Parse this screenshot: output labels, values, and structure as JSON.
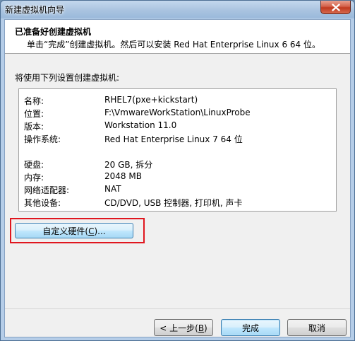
{
  "window": {
    "title": "新建虚拟机向导"
  },
  "header": {
    "title": "已准备好创建虚拟机",
    "subtitle": "单击“完成”创建虚拟机。然后可以安装 Red Hat Enterprise Linux 6 64 位。"
  },
  "summary": {
    "label": "将使用下列设置创建虚拟机:",
    "rows": [
      {
        "key": "名称:",
        "value": "RHEL7(pxe+kickstart)"
      },
      {
        "key": "位置:",
        "value": "F:\\VmwareWorkStation\\LinuxProbe"
      },
      {
        "key": "版本:",
        "value": "Workstation 11.0"
      },
      {
        "key": "操作系统:",
        "value": "Red Hat Enterprise Linux 7 64 位"
      },
      {
        "key": "硬盘:",
        "value": "20 GB, 拆分"
      },
      {
        "key": "内存:",
        "value": "2048 MB"
      },
      {
        "key": "网络适配器:",
        "value": "NAT"
      },
      {
        "key": "其他设备:",
        "value": "CD/DVD, USB 控制器, 打印机, 声卡"
      }
    ]
  },
  "buttons": {
    "customize_label": "自定义硬件(",
    "customize_accel": "C",
    "customize_suffix": ")...",
    "back_label": "< 上一步(",
    "back_accel": "B",
    "back_suffix": ")",
    "finish_label": "完成",
    "cancel_label": "取消"
  }
}
